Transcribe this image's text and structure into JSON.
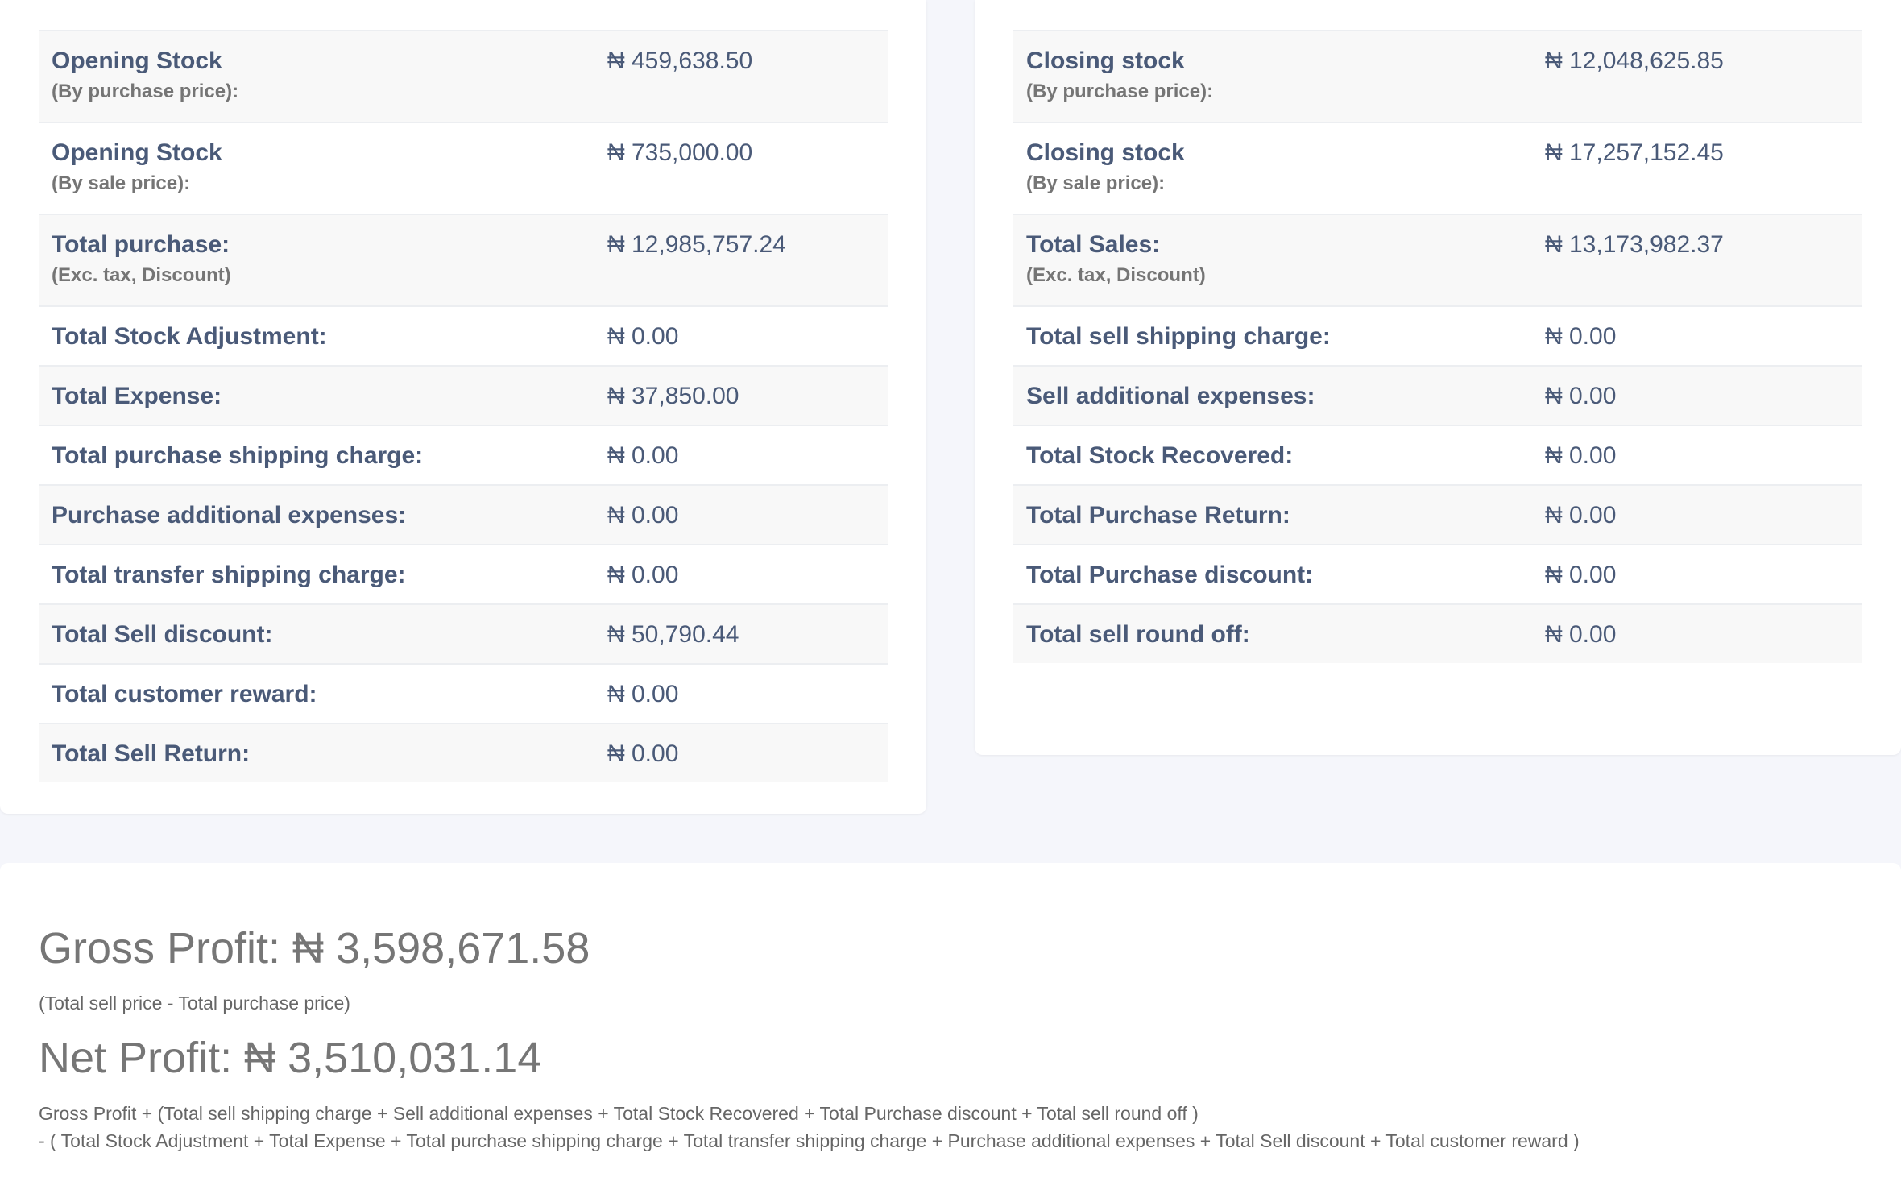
{
  "left_panel": {
    "rows": [
      {
        "label": "Opening Stock",
        "sub": "(By purchase price):",
        "value": "₦ 459,638.50"
      },
      {
        "label": "Opening Stock",
        "sub": "(By sale price):",
        "value": "₦ 735,000.00"
      },
      {
        "label": "Total purchase:",
        "sub": "(Exc. tax, Discount)",
        "value": "₦ 12,985,757.24"
      },
      {
        "label": "Total Stock Adjustment:",
        "value": "₦ 0.00"
      },
      {
        "label": "Total Expense:",
        "value": "₦ 37,850.00"
      },
      {
        "label": "Total purchase shipping charge:",
        "value": "₦ 0.00"
      },
      {
        "label": "Purchase additional expenses:",
        "value": "₦ 0.00"
      },
      {
        "label": "Total transfer shipping charge:",
        "value": "₦ 0.00"
      },
      {
        "label": "Total Sell discount:",
        "value": "₦ 50,790.44"
      },
      {
        "label": "Total customer reward:",
        "value": "₦ 0.00"
      },
      {
        "label": "Total Sell Return:",
        "value": "₦ 0.00"
      }
    ]
  },
  "right_panel": {
    "rows": [
      {
        "label": "Closing stock",
        "sub": "(By purchase price):",
        "value": "₦ 12,048,625.85"
      },
      {
        "label": "Closing stock",
        "sub": "(By sale price):",
        "value": "₦ 17,257,152.45"
      },
      {
        "label": "Total Sales:",
        "sub": "(Exc. tax, Discount)",
        "value": "₦ 13,173,982.37"
      },
      {
        "label": "Total sell shipping charge:",
        "value": "₦ 0.00"
      },
      {
        "label": "Sell additional expenses:",
        "value": "₦ 0.00"
      },
      {
        "label": "Total Stock Recovered:",
        "value": "₦ 0.00"
      },
      {
        "label": "Total Purchase Return:",
        "value": "₦ 0.00"
      },
      {
        "label": "Total Purchase discount:",
        "value": "₦ 0.00"
      },
      {
        "label": "Total sell round off:",
        "value": "₦ 0.00"
      }
    ]
  },
  "summary": {
    "gross_profit": "Gross Profit: ₦ 3,598,671.58",
    "gross_note": "(Total sell price - Total purchase price)",
    "net_profit": "Net Profit: ₦ 3,510,031.14",
    "net_note_line1": "Gross Profit + (Total sell shipping charge + Sell additional expenses + Total Stock Recovered + Total Purchase discount + Total sell round off )",
    "net_note_line2": "- ( Total Stock Adjustment + Total Expense + Total purchase shipping charge + Total transfer shipping charge + Purchase additional expenses + Total Sell discount + Total customer reward )"
  }
}
